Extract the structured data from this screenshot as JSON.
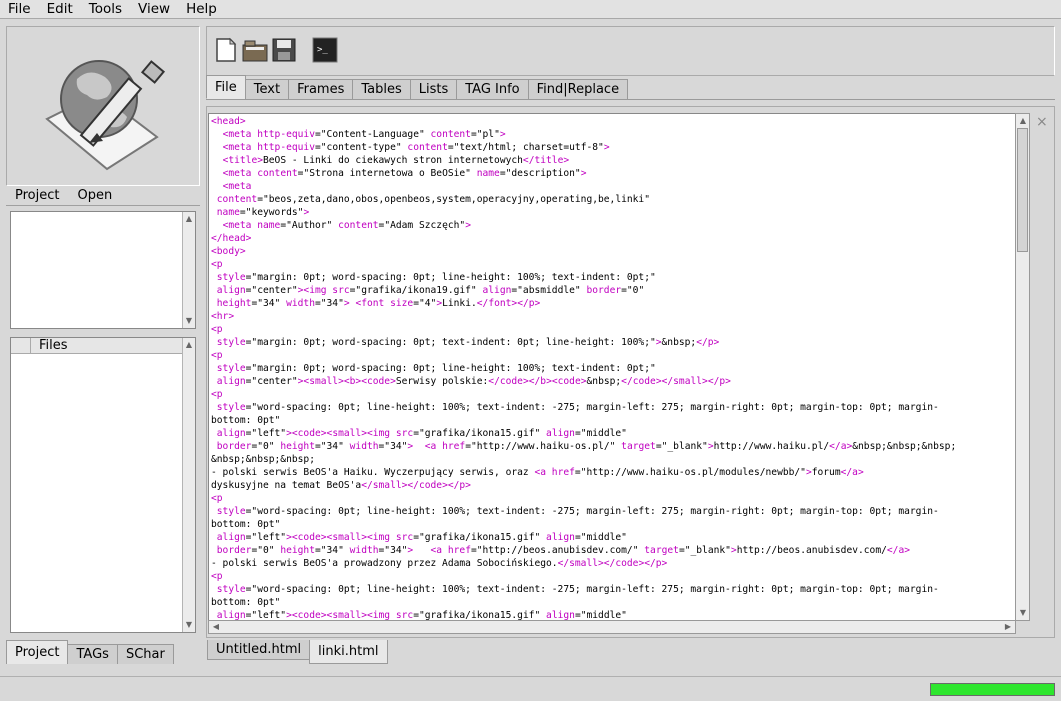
{
  "menu": [
    "File",
    "Edit",
    "Tools",
    "View",
    "Help"
  ],
  "project_tabs": [
    "Project",
    "Open"
  ],
  "files_column": "Files",
  "left_bottom_tabs": [
    "Project",
    "TAGs",
    "SChar"
  ],
  "format_tabs": [
    "File",
    "Text",
    "Frames",
    "Tables",
    "Lists",
    "TAG Info",
    "Find|Replace"
  ],
  "doc_tabs": [
    "Untitled.html",
    "linki.html"
  ],
  "toolbar_icons": [
    "new-document-icon",
    "open-folder-icon",
    "save-icon",
    "terminal-icon"
  ],
  "close_glyph": "×",
  "progress_fraction": 1.0,
  "code_lines": [
    "<head>",
    "  <meta http-equiv=\"Content-Language\" content=\"pl\">",
    "  <meta http-equiv=\"content-type\" content=\"text/html; charset=utf-8\">",
    "  <title>BeOS - Linki do ciekawych stron internetowych</title>",
    "  <meta content=\"Strona internetowa o BeOSie\" name=\"description\">",
    "  <meta",
    " content=\"beos,zeta,dano,obos,openbeos,system,operacyjny,operating,be,linki\"",
    " name=\"keywords\">",
    "  <meta name=\"Author\" content=\"Adam Szczęch\">",
    "</head>",
    "<body>",
    "<p",
    " style=\"margin: 0pt; word-spacing: 0pt; line-height: 100%; text-indent: 0pt;\"",
    " align=\"center\"><img src=\"grafika/ikona19.gif\" align=\"absmiddle\" border=\"0\"",
    " height=\"34\" width=\"34\"> <font size=\"4\">Linki.</font></p>",
    "<hr>",
    "<p",
    " style=\"margin: 0pt; word-spacing: 0pt; text-indent: 0pt; line-height: 100%;\">&nbsp;</p>",
    "<p",
    " style=\"margin: 0pt; word-spacing: 0pt; line-height: 100%; text-indent: 0pt;\"",
    " align=\"center\"><small><b><code>Serwisy polskie:</code></b><code>&nbsp;</code></small></p>",
    "<p",
    " style=\"word-spacing: 0pt; line-height: 100%; text-indent: -275; margin-left: 275; margin-right: 0pt; margin-top: 0pt; margin-",
    "bottom: 0pt\"",
    " align=\"left\"><code><small><img src=\"grafika/ikona15.gif\" align=\"middle\"",
    " border=\"0\" height=\"34\" width=\"34\">  <a href=\"http://www.haiku-os.pl/\" target=\"_blank\">http://www.haiku.pl/</a>&nbsp;&nbsp;&nbsp;",
    "&nbsp;&nbsp;&nbsp;",
    "- polski serwis BeOS'a Haiku. Wyczerpujący serwis, oraz <a href=\"http://www.haiku-os.pl/modules/newbb/\">forum</a>",
    "dyskusyjne na temat BeOS'a</small></code></p>",
    "<p",
    " style=\"word-spacing: 0pt; line-height: 100%; text-indent: -275; margin-left: 275; margin-right: 0pt; margin-top: 0pt; margin-",
    "bottom: 0pt\"",
    " align=\"left\"><code><small><img src=\"grafika/ikona15.gif\" align=\"middle\"",
    " border=\"0\" height=\"34\" width=\"34\">   <a href=\"http://beos.anubisdev.com/\" target=\"_blank\">http://beos.anubisdev.com/</a>",
    "- polski serwis BeOS'a prowadzony przez Adama Sobocińskiego.</small></code></p>",
    "<p",
    " style=\"word-spacing: 0pt; line-height: 100%; text-indent: -275; margin-left: 275; margin-right: 0pt; margin-top: 0pt; margin-",
    "bottom: 0pt\"",
    " align=\"left\"><code><small><img src=\"grafika/ikona15.gif\" align=\"middle\""
  ]
}
